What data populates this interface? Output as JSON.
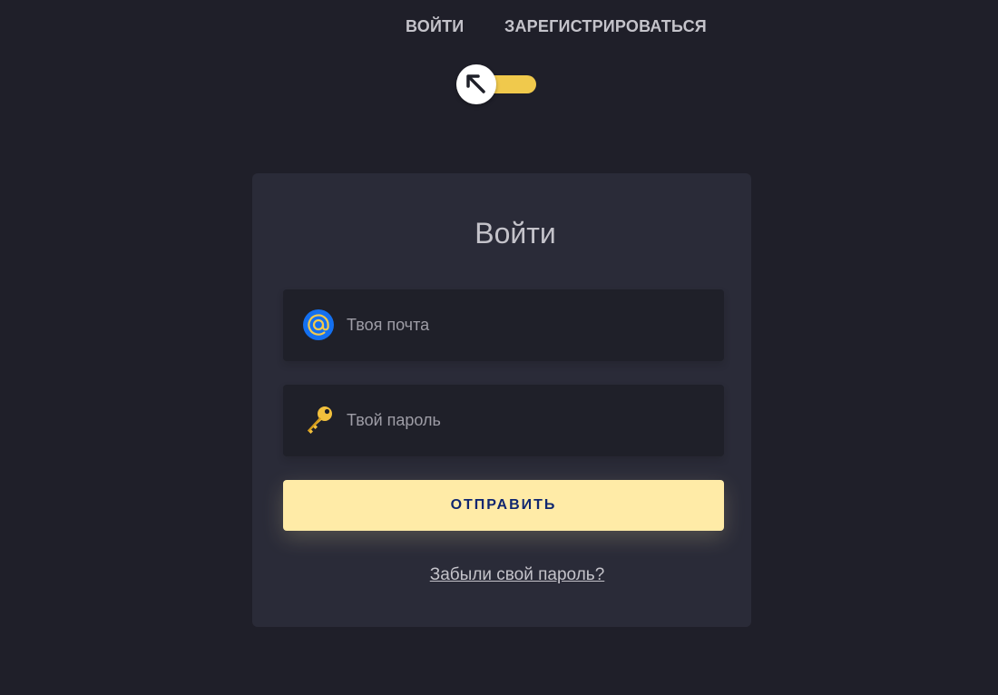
{
  "nav": {
    "login_label": "ВОЙТИ",
    "register_label": "ЗАРЕГИСТРИРОВАТЬСЯ"
  },
  "toggle": {
    "icon": "arrow-up-left-icon",
    "accent_color": "#f0c94c"
  },
  "form": {
    "title": "Войти",
    "email": {
      "icon": "at-sign-icon",
      "placeholder": "Твоя почта",
      "value": ""
    },
    "password": {
      "icon": "key-icon",
      "placeholder": "Твой пароль",
      "value": ""
    },
    "submit_label": "ОТПРАВИТЬ",
    "forgot_label": "Забыли свой пароль?"
  },
  "colors": {
    "background": "#1f1f29",
    "card": "#2a2b38",
    "button": "#ffeba7",
    "button_text": "#102770"
  }
}
